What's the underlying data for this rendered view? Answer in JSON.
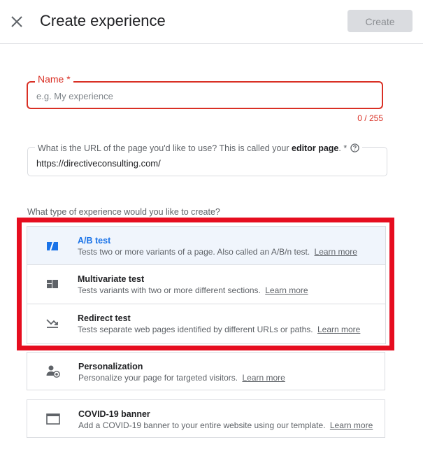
{
  "header": {
    "title": "Create experience",
    "create_label": "Create"
  },
  "name_field": {
    "label": "Name *",
    "placeholder": "e.g. My experience",
    "value": "",
    "counter": "0 / 255"
  },
  "url_field": {
    "label_prefix": "What is the URL of the page you'd like to use? This is called your ",
    "label_bold": "editor page",
    "label_suffix": ". *",
    "value": "https://directiveconsulting.com/"
  },
  "experience_type": {
    "question": "What type of experience would you like to create?",
    "options": [
      {
        "title": "A/B test",
        "description": "Tests two or more variants of a page. Also called an A/B/n test.",
        "link": "Learn more",
        "icon": "ab-test-icon",
        "selected": true
      },
      {
        "title": "Multivariate test",
        "description": "Tests variants with two or more different sections.",
        "link": "Learn more",
        "icon": "multivariate-grid-icon",
        "selected": false
      },
      {
        "title": "Redirect test",
        "description": "Tests separate web pages identified by different URLs or paths.",
        "link": "Learn more",
        "icon": "redirect-arrow-icon",
        "selected": false
      },
      {
        "title": "Personalization",
        "description": "Personalize your page for targeted visitors.",
        "link": "Learn more",
        "icon": "personalization-user-icon",
        "selected": false
      },
      {
        "title": "COVID-19 banner",
        "description": "Add a COVID-19 banner to your entire website using our template.",
        "link": "Learn more",
        "icon": "banner-window-icon",
        "selected": false
      }
    ]
  },
  "colors": {
    "error_red": "#d93025",
    "selected_blue": "#1a73e8",
    "highlight_red": "#e60d1f"
  }
}
